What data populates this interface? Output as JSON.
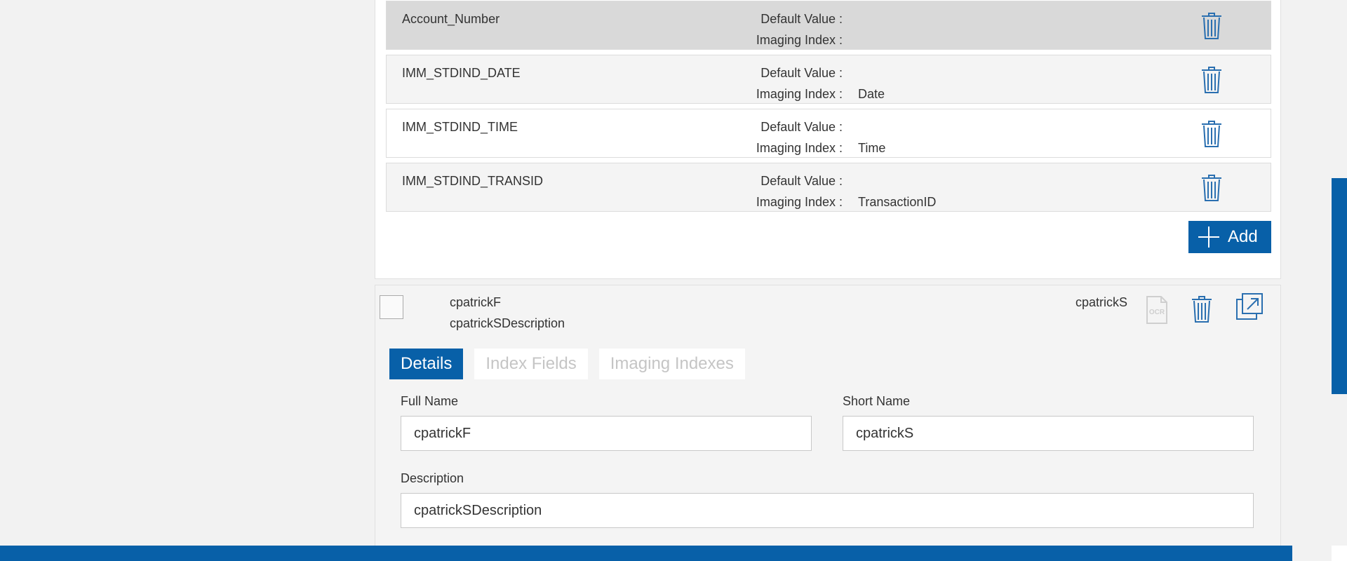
{
  "index_fields": {
    "rows": [
      {
        "name": "Account_Number",
        "default_value_label": "Default Value :",
        "imaging_index_label": "Imaging Index :",
        "imaging_index_value": "",
        "bg": "#d9d9d9"
      },
      {
        "name": "IMM_STDIND_DATE",
        "default_value_label": "Default Value :",
        "imaging_index_label": "Imaging Index :",
        "imaging_index_value": "Date",
        "bg": "#f4f4f4"
      },
      {
        "name": "IMM_STDIND_TIME",
        "default_value_label": "Default Value :",
        "imaging_index_label": "Imaging Index :",
        "imaging_index_value": "Time",
        "bg": "#ffffff"
      },
      {
        "name": "IMM_STDIND_TRANSID",
        "default_value_label": "Default Value :",
        "imaging_index_label": "Imaging Index :",
        "imaging_index_value": "TransactionID",
        "bg": "#f4f4f4"
      }
    ],
    "add_label": "Add"
  },
  "document_type": {
    "full_name": "cpatrickF",
    "description": "cpatrickSDescription",
    "short_name": "cpatrickS",
    "ocr_icon_text": "OCR",
    "tabs": [
      {
        "label": "Details",
        "active": true
      },
      {
        "label": "Index Fields",
        "active": false
      },
      {
        "label": "Imaging Indexes",
        "active": false
      }
    ],
    "form": {
      "full_name_label": "Full Name",
      "full_name_value": "cpatrickF",
      "short_name_label": "Short Name",
      "short_name_value": "cpatrickS",
      "description_label": "Description",
      "description_value": "cpatrickSDescription"
    }
  },
  "colors": {
    "accent": "#0860a8",
    "page_bg": "#f2f2f2",
    "icon_stroke": "#2a6fb0"
  }
}
